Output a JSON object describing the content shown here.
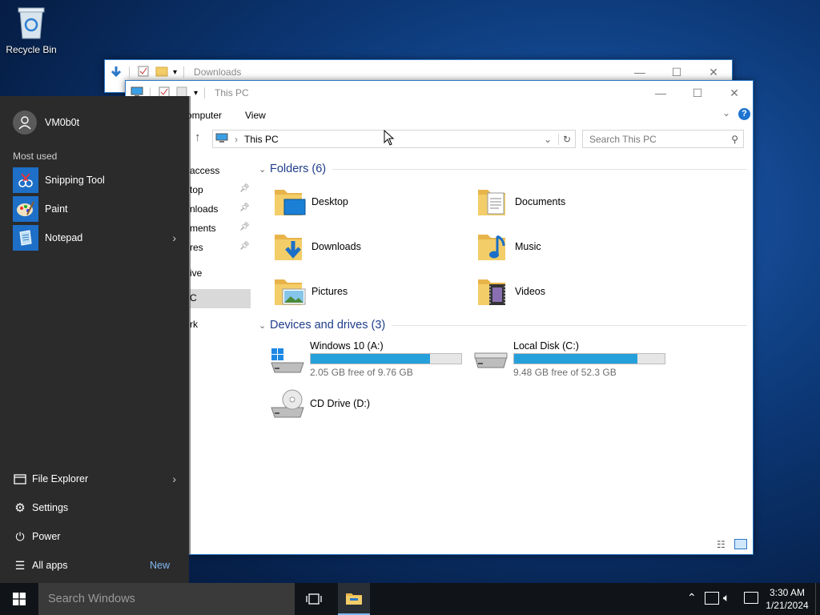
{
  "desktop": {
    "recycle_bin_label": "Recycle Bin"
  },
  "back_window": {
    "title": "Downloads"
  },
  "explorer": {
    "title": "This PC",
    "ribbon_tabs": [
      "Computer",
      "View"
    ],
    "ribbon_tab_first_visible": "omputer",
    "address": "This PC",
    "search_placeholder": "Search This PC",
    "nav_items_partial": [
      "access",
      "top",
      "nloads",
      "ments",
      "res",
      "ive",
      "C",
      "rk"
    ],
    "folders_header": "Folders (6)",
    "folders": [
      "Desktop",
      "Documents",
      "Downloads",
      "Music",
      "Pictures",
      "Videos"
    ],
    "drives_header": "Devices and drives (3)",
    "drives": [
      {
        "name": "Windows 10 (A:)",
        "free": "2.05 GB free of 9.76 GB",
        "used_fraction": 0.79
      },
      {
        "name": "Local Disk (C:)",
        "free": "9.48 GB free of 52.3 GB",
        "used_fraction": 0.82
      },
      {
        "name": "CD Drive (D:)"
      }
    ]
  },
  "start_menu": {
    "user": "VM0b0t",
    "most_used_label": "Most used",
    "apps": [
      "Snipping Tool",
      "Paint",
      "Notepad"
    ],
    "bottom": {
      "file_explorer": "File Explorer",
      "settings": "Settings",
      "power": "Power",
      "all_apps": "All apps",
      "new_badge": "New"
    }
  },
  "taskbar": {
    "search_placeholder": "Search Windows",
    "time": "3:30 AM",
    "date": "1/21/2024"
  },
  "colors": {
    "accent": "#2b78c5",
    "drive_bar": "#26a0da",
    "folder": "#f3cd68",
    "section_head": "#1e3d8a"
  }
}
